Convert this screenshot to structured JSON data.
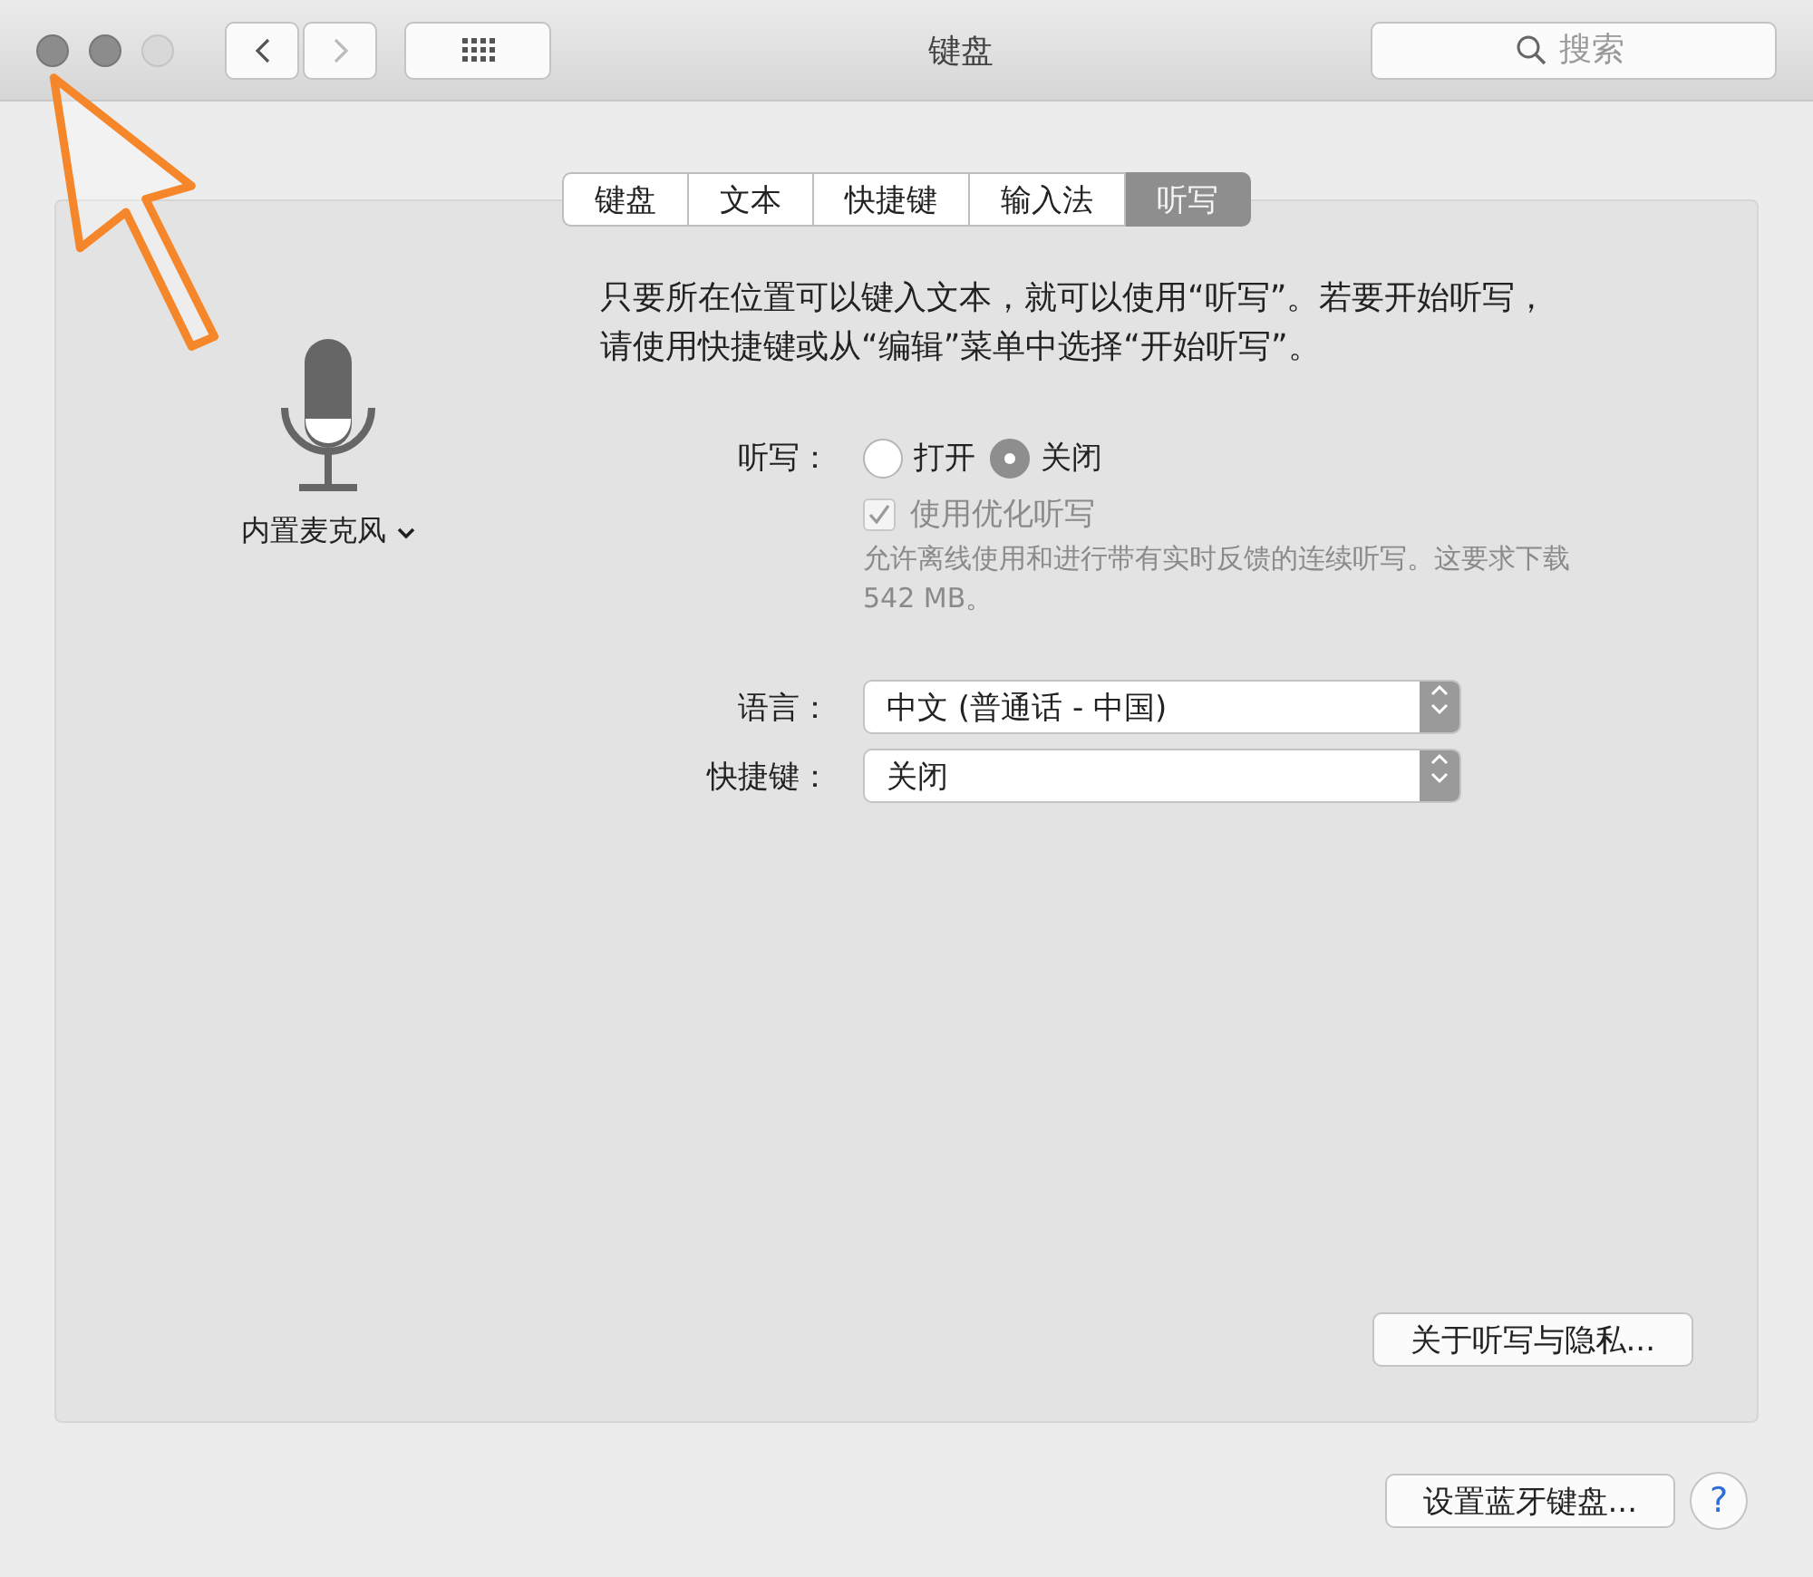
{
  "window": {
    "title": "键盘",
    "traffic_lights": [
      {
        "disabled": false
      },
      {
        "disabled": false
      },
      {
        "disabled": true
      }
    ]
  },
  "toolbar": {
    "back_disabled": false,
    "forward_disabled": true,
    "search": {
      "placeholder": "搜索"
    }
  },
  "tabs": [
    {
      "label": "键盘",
      "selected": false
    },
    {
      "label": "文本",
      "selected": false
    },
    {
      "label": "快捷键",
      "selected": false
    },
    {
      "label": "输入法",
      "selected": false
    },
    {
      "label": "听写",
      "selected": true
    }
  ],
  "microphone": {
    "label": "内置麦克风"
  },
  "description": "只要所在位置可以键入文本，就可以使用“听写”。若要开始听写，请使用快捷键或从“编辑”菜单中选择“开始听写”。",
  "dictation": {
    "label": "听写：",
    "options": [
      {
        "label": "打开",
        "selected": false
      },
      {
        "label": "关闭",
        "selected": true
      }
    ],
    "enhanced": {
      "label": "使用优化听写",
      "checked": true,
      "disabled": true,
      "note": "允许离线使用和进行带有实时反馈的连续听写。这要求下载 542 MB。"
    }
  },
  "selects": [
    {
      "label": "语言：",
      "value": "中文 (普通话 - 中国)"
    },
    {
      "label": "快捷键：",
      "value": "关闭"
    }
  ],
  "privacy_button": "关于听写与隐私...",
  "bluetooth_button": "设置蓝牙键盘...",
  "help_button": "?",
  "annotation": {
    "kind": "arrow"
  }
}
